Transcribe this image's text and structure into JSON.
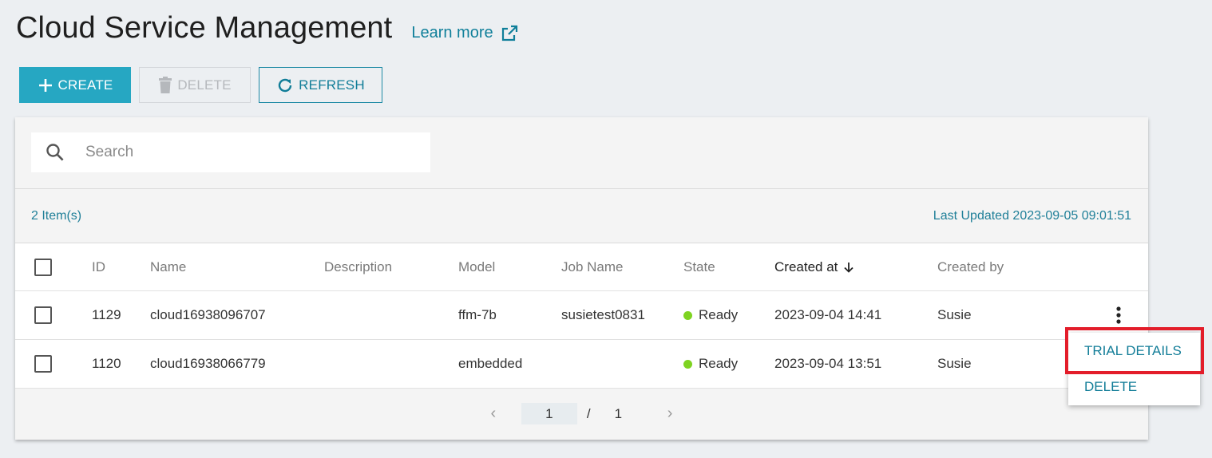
{
  "header": {
    "title": "Cloud Service Management",
    "learn_more": "Learn more"
  },
  "toolbar": {
    "create_label": "CREATE",
    "delete_label": "DELETE",
    "refresh_label": "REFRESH"
  },
  "search": {
    "placeholder": "Search",
    "value": ""
  },
  "summary": {
    "count": "2 Item(s)",
    "last_updated": "Last Updated 2023-09-05 09:01:51"
  },
  "table": {
    "columns": {
      "id": "ID",
      "name": "Name",
      "description": "Description",
      "model": "Model",
      "job_name": "Job Name",
      "state": "State",
      "created_at": "Created at",
      "created_by": "Created by"
    },
    "sort": {
      "column": "created_at",
      "direction": "descending"
    },
    "rows": [
      {
        "id": "1129",
        "name": "cloud16938096707",
        "description": "",
        "model": "ffm-7b",
        "job_name": "susietest0831",
        "state": "Ready",
        "created_at": "2023-09-04 14:41",
        "created_by": "Susie"
      },
      {
        "id": "1120",
        "name": "cloud16938066779",
        "description": "",
        "model": "embedded",
        "job_name": "",
        "state": "Ready",
        "created_at": "2023-09-04 13:51",
        "created_by": "Susie"
      }
    ]
  },
  "pagination": {
    "current": "1",
    "separator": "/",
    "total": "1"
  },
  "row_menu": {
    "items": [
      "TRIAL DETAILS",
      "DELETE"
    ]
  },
  "colors": {
    "accent": "#26a7c2",
    "link": "#0f7f9a",
    "ready": "#7ed321",
    "highlight": "#e31d2a"
  }
}
